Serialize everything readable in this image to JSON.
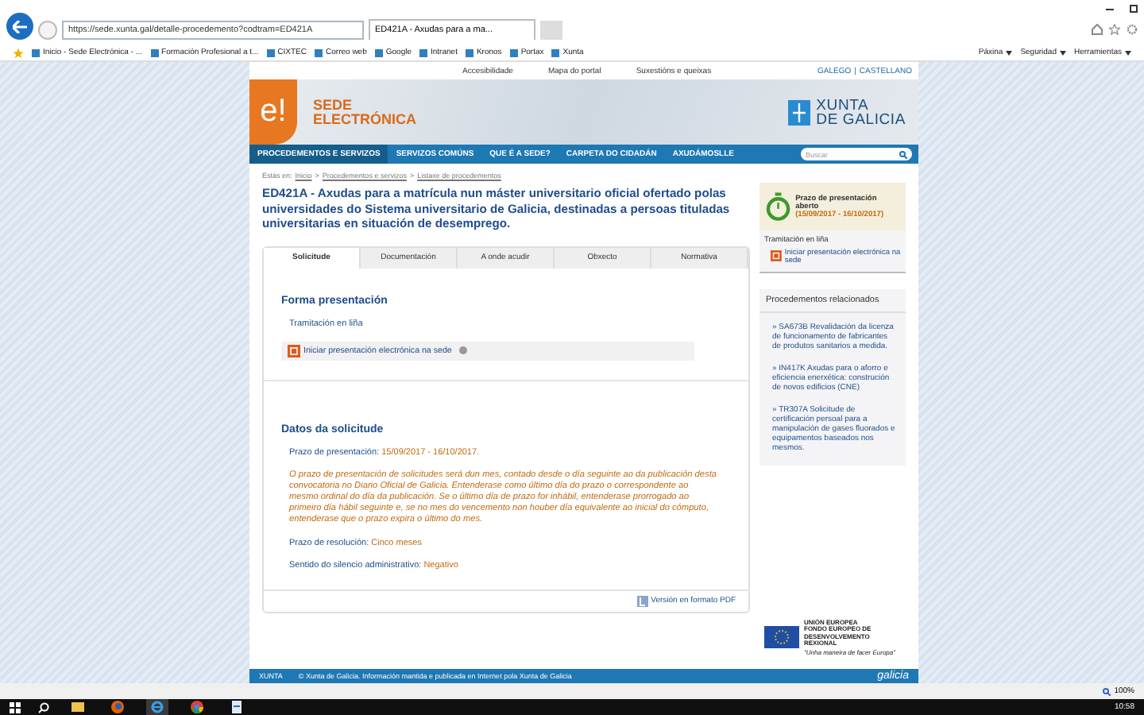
{
  "browser": {
    "address": "https://sede.xunta.gal/detalle-procedemento?codtram=ED421A",
    "tab": "ED421A - Axudas para a ma...",
    "favorites": [
      "Inicio - Sede Electrónica - ...",
      "Formación Profesional a t...",
      "CIXTEC",
      "Correo web",
      "Google",
      "Intranet",
      "Kronos",
      "Portax",
      "Xunta"
    ],
    "commands": [
      "Páxina",
      "Seguridad",
      "Herramientas"
    ]
  },
  "top_links": [
    "Accesibilidade",
    "Mapa do portal",
    "Suxestións e queixas"
  ],
  "languages": [
    "GALEGO",
    "CASTELLANO"
  ],
  "language_separator": "|",
  "banner": {
    "mark": "e!",
    "title_lines": [
      "SEDE",
      "ELECTRÓNICA"
    ],
    "xunta_lines": [
      "XUNTA",
      "DE GALICIA"
    ]
  },
  "nav": [
    {
      "label": "PROCEDEMENTOS E SERVIZOS",
      "selected": true
    },
    {
      "label": "SERVIZOS COMÚNS",
      "selected": false
    },
    {
      "label": "QUE É A SEDE?",
      "selected": false
    },
    {
      "label": "CARPETA DO CIDADÁN",
      "selected": false
    },
    {
      "label": "AXUDÁMOSLLE",
      "selected": false
    }
  ],
  "search": {
    "placeholder": "Buscar"
  },
  "breadcrumb": {
    "label": "Estás en:",
    "separator": ">",
    "links": [
      "Inicio",
      "Procedementos e servizos",
      "Listaxe de procedementos"
    ]
  },
  "title": "ED421A - Axudas para a matrícula nun máster universitario oficial ofertado polas universidades do Sistema universitario de Galicia, destinadas a persoas tituladas universitarias en situación de desemprego.",
  "tabs": [
    {
      "label": "Solicitude",
      "selected": true
    },
    {
      "label": "Documentación",
      "selected": false
    },
    {
      "label": "A onde acudir",
      "selected": false
    },
    {
      "label": "Obxecto",
      "selected": false
    },
    {
      "label": "Normativa",
      "selected": false
    }
  ],
  "forma": {
    "heading": "Forma presentación",
    "mode": "Tramitación en liña",
    "link": "Iniciar presentación electrónica na sede"
  },
  "datos": {
    "heading": "Datos da solicitude",
    "deadline": {
      "label": "Prazo de presentación:",
      "value": "15/09/2017 - 16/10/2017."
    },
    "note": "O prazo de presentación de solicitudes será dun mes, contado desde o día seguinte ao da publicación desta convocatoria no Diario Oficial de Galicia. Entenderase como último día do prazo o correspondente ao mesmo ordinal do día da publicación. Se o último día de prazo for inhábil, entenderase prorrogado ao primeiro día hábil seguinte e, se no mes do vencemento non houber día equivalente ao inicial do cómputo, entenderase que o prazo expira o último do mes.",
    "fields": [
      {
        "label": "Prazo de resolución:",
        "value": "Cinco meses"
      },
      {
        "label": "Sentido do silencio administrativo:",
        "value": "Negativo"
      }
    ]
  },
  "pdf_link": "Versión en formato PDF",
  "status_box": {
    "title": "Prazo de presentación aberto",
    "dates": "(15/09/2017 - 16/10/2017)"
  },
  "side_tramitacion": {
    "label": "Tramitación en liña",
    "link": "Iniciar presentación electrónica na sede"
  },
  "related": {
    "heading": "Procedementos relacionados",
    "marker": "»",
    "items": [
      {
        "code": "SA673B",
        "text": "Revalidación da licenza de funcionamento de fabricantes de produtos sanitarios a medida."
      },
      {
        "code": "IN417K",
        "text": "Axudas para o aforro e eficiencia enerxética: construción de novos edificios (CNE)"
      },
      {
        "code": "TR307A",
        "text": "Solicitude de certificación persoal para a manipulación de gases fluorados e equipamentos baseados nos mesmos."
      }
    ]
  },
  "eu_logo": {
    "lines": [
      "UNIÓN EUROPEA",
      "FONDO EUROPEO DE DESENVOLVEMENTO REXIONAL"
    ],
    "motto": "\"Unha maneira de facer Europa\""
  },
  "footer": {
    "brand": "XUNTA",
    "text": "© Xunta de Galicia. Información mantida e publicada en Internet pola Xunta de Galicia",
    "logo": "galicia"
  },
  "status_bar": {
    "zoom": "100%"
  },
  "taskbar": {
    "apps": [
      {
        "kind": "folder",
        "selected": false
      },
      {
        "kind": "firefox",
        "selected": false
      },
      {
        "kind": "ie",
        "selected": true
      },
      {
        "kind": "chrome",
        "selected": false
      },
      {
        "kind": "file",
        "selected": false
      }
    ],
    "time": "10:58"
  }
}
